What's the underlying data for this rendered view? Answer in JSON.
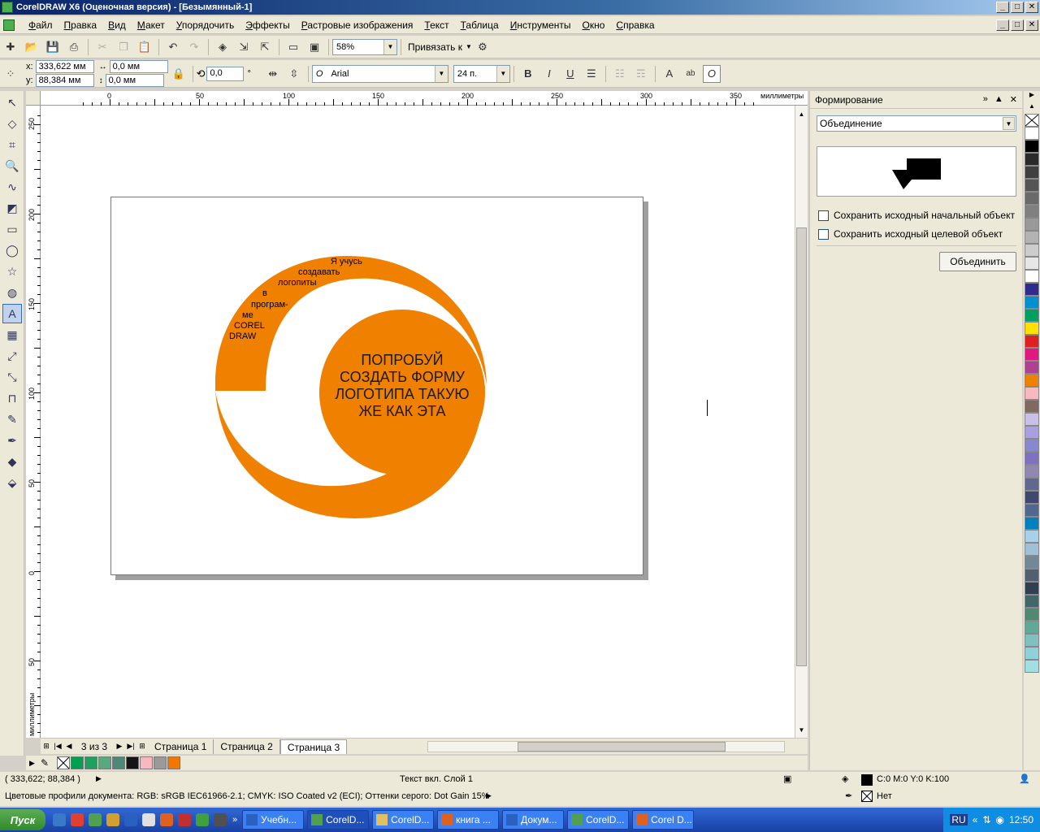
{
  "window": {
    "title": "CorelDRAW X6 (Оценочная версия) - [Безымянный-1]",
    "min": "_",
    "max": "□",
    "close": "✕"
  },
  "menu": [
    "Файл",
    "Правка",
    "Вид",
    "Макет",
    "Упорядочить",
    "Эффекты",
    "Растровые изображения",
    "Текст",
    "Таблица",
    "Инструменты",
    "Окно",
    "Справка"
  ],
  "toolbar1": {
    "zoom": "58%",
    "snap_label": "Привязать к"
  },
  "property_bar": {
    "x_label": "x:",
    "x_value": "333,622 мм",
    "y_label": "y:",
    "y_value": "88,384 мм",
    "w_value": "0,0 мм",
    "h_value": "0,0 мм",
    "angle": "0,0",
    "degree": "°",
    "font": "Arial",
    "font_size": "24 п."
  },
  "ruler": {
    "unit": "миллиметры",
    "top_labels": [
      "0",
      "50",
      "100",
      "150",
      "200",
      "250",
      "300",
      "350"
    ],
    "left_labels": [
      "250",
      "200",
      "150",
      "100",
      "50",
      "0",
      "50"
    ]
  },
  "artwork": {
    "arc_text": [
      "Я учусь",
      "создавать",
      "логопиты",
      "в",
      "програм-",
      "ме",
      "COREL",
      "DRAW"
    ],
    "center_text": [
      "ПОПРОБУЙ",
      "СОЗДАТЬ ФОРМУ",
      "ЛОГОТИПА ТАКУЮ",
      "ЖЕ КАК ЭТА"
    ],
    "orange": "#f08000"
  },
  "pagenav": {
    "count": "3 из 3",
    "tabs": [
      "Страница 1",
      "Страница 2",
      "Страница 3"
    ],
    "active": 2
  },
  "doc_palette": [
    "#ffffff",
    "#00a050",
    "#20a060",
    "#5aa880",
    "#508878",
    "#151515",
    "#f8b8c0",
    "#9a9a9a",
    "#f07800"
  ],
  "docker": {
    "title": "Формирование",
    "mode": "Объединение",
    "keep_source": "Сохранить исходный начальный объект",
    "keep_target": "Сохранить исходный целевой объект",
    "button": "Объединить"
  },
  "palette": [
    "#ffffff",
    "#000000",
    "#2a2a2a",
    "#404040",
    "#555555",
    "#6a6a6a",
    "#808080",
    "#999999",
    "#b3b3b3",
    "#cccccc",
    "#e6e6e6",
    "#ffffff",
    "#2e2c8c",
    "#0090d0",
    "#00a060",
    "#ffe000",
    "#e02020",
    "#e01880",
    "#b04090",
    "#f08000",
    "#f8b8c0",
    "#806a60",
    "#c8c0e8",
    "#a8a0e0",
    "#8888d0",
    "#8070c0",
    "#9088b0",
    "#606890",
    "#404870",
    "#506890",
    "#0080c0",
    "#a8d0e8",
    "#a0c0d8",
    "#708898",
    "#506070",
    "#304050",
    "#406868",
    "#508870",
    "#60a898",
    "#80c0c0",
    "#90d0d8",
    "#a0e0e0"
  ],
  "status": {
    "coords": "( 333,622; 88,384 )",
    "layer": "Текст вкл. Слой 1",
    "fill": "C:0 M:0 Y:0 K:100",
    "outline": "Нет",
    "profiles": "Цветовые профили документа: RGB: sRGB IEC61966-2.1; CMYK: ISO Coated v2 (ECI); Оттенки серого: Dot Gain 15%"
  },
  "taskbar": {
    "start": "Пуск",
    "tasks": [
      "Учебн...",
      "CorelD...",
      "CorelD...",
      "книга ...",
      "Докум...",
      "CorelD...",
      "Corel D..."
    ],
    "active": 1,
    "lang": "RU",
    "time": "12:50"
  }
}
